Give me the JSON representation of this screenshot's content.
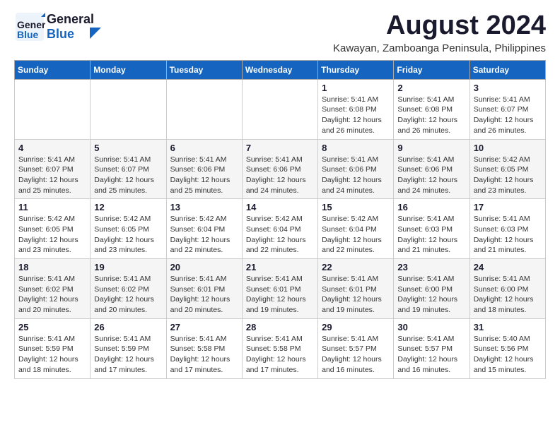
{
  "header": {
    "logo_general": "General",
    "logo_blue": "Blue",
    "month": "August 2024",
    "location": "Kawayan, Zamboanga Peninsula, Philippines"
  },
  "days_of_week": [
    "Sunday",
    "Monday",
    "Tuesday",
    "Wednesday",
    "Thursday",
    "Friday",
    "Saturday"
  ],
  "weeks": [
    [
      {
        "day": "",
        "info": ""
      },
      {
        "day": "",
        "info": ""
      },
      {
        "day": "",
        "info": ""
      },
      {
        "day": "",
        "info": ""
      },
      {
        "day": "1",
        "info": "Sunrise: 5:41 AM\nSunset: 6:08 PM\nDaylight: 12 hours\nand 26 minutes."
      },
      {
        "day": "2",
        "info": "Sunrise: 5:41 AM\nSunset: 6:08 PM\nDaylight: 12 hours\nand 26 minutes."
      },
      {
        "day": "3",
        "info": "Sunrise: 5:41 AM\nSunset: 6:07 PM\nDaylight: 12 hours\nand 26 minutes."
      }
    ],
    [
      {
        "day": "4",
        "info": "Sunrise: 5:41 AM\nSunset: 6:07 PM\nDaylight: 12 hours\nand 25 minutes."
      },
      {
        "day": "5",
        "info": "Sunrise: 5:41 AM\nSunset: 6:07 PM\nDaylight: 12 hours\nand 25 minutes."
      },
      {
        "day": "6",
        "info": "Sunrise: 5:41 AM\nSunset: 6:06 PM\nDaylight: 12 hours\nand 25 minutes."
      },
      {
        "day": "7",
        "info": "Sunrise: 5:41 AM\nSunset: 6:06 PM\nDaylight: 12 hours\nand 24 minutes."
      },
      {
        "day": "8",
        "info": "Sunrise: 5:41 AM\nSunset: 6:06 PM\nDaylight: 12 hours\nand 24 minutes."
      },
      {
        "day": "9",
        "info": "Sunrise: 5:41 AM\nSunset: 6:06 PM\nDaylight: 12 hours\nand 24 minutes."
      },
      {
        "day": "10",
        "info": "Sunrise: 5:42 AM\nSunset: 6:05 PM\nDaylight: 12 hours\nand 23 minutes."
      }
    ],
    [
      {
        "day": "11",
        "info": "Sunrise: 5:42 AM\nSunset: 6:05 PM\nDaylight: 12 hours\nand 23 minutes."
      },
      {
        "day": "12",
        "info": "Sunrise: 5:42 AM\nSunset: 6:05 PM\nDaylight: 12 hours\nand 23 minutes."
      },
      {
        "day": "13",
        "info": "Sunrise: 5:42 AM\nSunset: 6:04 PM\nDaylight: 12 hours\nand 22 minutes."
      },
      {
        "day": "14",
        "info": "Sunrise: 5:42 AM\nSunset: 6:04 PM\nDaylight: 12 hours\nand 22 minutes."
      },
      {
        "day": "15",
        "info": "Sunrise: 5:42 AM\nSunset: 6:04 PM\nDaylight: 12 hours\nand 22 minutes."
      },
      {
        "day": "16",
        "info": "Sunrise: 5:41 AM\nSunset: 6:03 PM\nDaylight: 12 hours\nand 21 minutes."
      },
      {
        "day": "17",
        "info": "Sunrise: 5:41 AM\nSunset: 6:03 PM\nDaylight: 12 hours\nand 21 minutes."
      }
    ],
    [
      {
        "day": "18",
        "info": "Sunrise: 5:41 AM\nSunset: 6:02 PM\nDaylight: 12 hours\nand 20 minutes."
      },
      {
        "day": "19",
        "info": "Sunrise: 5:41 AM\nSunset: 6:02 PM\nDaylight: 12 hours\nand 20 minutes."
      },
      {
        "day": "20",
        "info": "Sunrise: 5:41 AM\nSunset: 6:01 PM\nDaylight: 12 hours\nand 20 minutes."
      },
      {
        "day": "21",
        "info": "Sunrise: 5:41 AM\nSunset: 6:01 PM\nDaylight: 12 hours\nand 19 minutes."
      },
      {
        "day": "22",
        "info": "Sunrise: 5:41 AM\nSunset: 6:01 PM\nDaylight: 12 hours\nand 19 minutes."
      },
      {
        "day": "23",
        "info": "Sunrise: 5:41 AM\nSunset: 6:00 PM\nDaylight: 12 hours\nand 19 minutes."
      },
      {
        "day": "24",
        "info": "Sunrise: 5:41 AM\nSunset: 6:00 PM\nDaylight: 12 hours\nand 18 minutes."
      }
    ],
    [
      {
        "day": "25",
        "info": "Sunrise: 5:41 AM\nSunset: 5:59 PM\nDaylight: 12 hours\nand 18 minutes."
      },
      {
        "day": "26",
        "info": "Sunrise: 5:41 AM\nSunset: 5:59 PM\nDaylight: 12 hours\nand 17 minutes."
      },
      {
        "day": "27",
        "info": "Sunrise: 5:41 AM\nSunset: 5:58 PM\nDaylight: 12 hours\nand 17 minutes."
      },
      {
        "day": "28",
        "info": "Sunrise: 5:41 AM\nSunset: 5:58 PM\nDaylight: 12 hours\nand 17 minutes."
      },
      {
        "day": "29",
        "info": "Sunrise: 5:41 AM\nSunset: 5:57 PM\nDaylight: 12 hours\nand 16 minutes."
      },
      {
        "day": "30",
        "info": "Sunrise: 5:41 AM\nSunset: 5:57 PM\nDaylight: 12 hours\nand 16 minutes."
      },
      {
        "day": "31",
        "info": "Sunrise: 5:40 AM\nSunset: 5:56 PM\nDaylight: 12 hours\nand 15 minutes."
      }
    ]
  ]
}
